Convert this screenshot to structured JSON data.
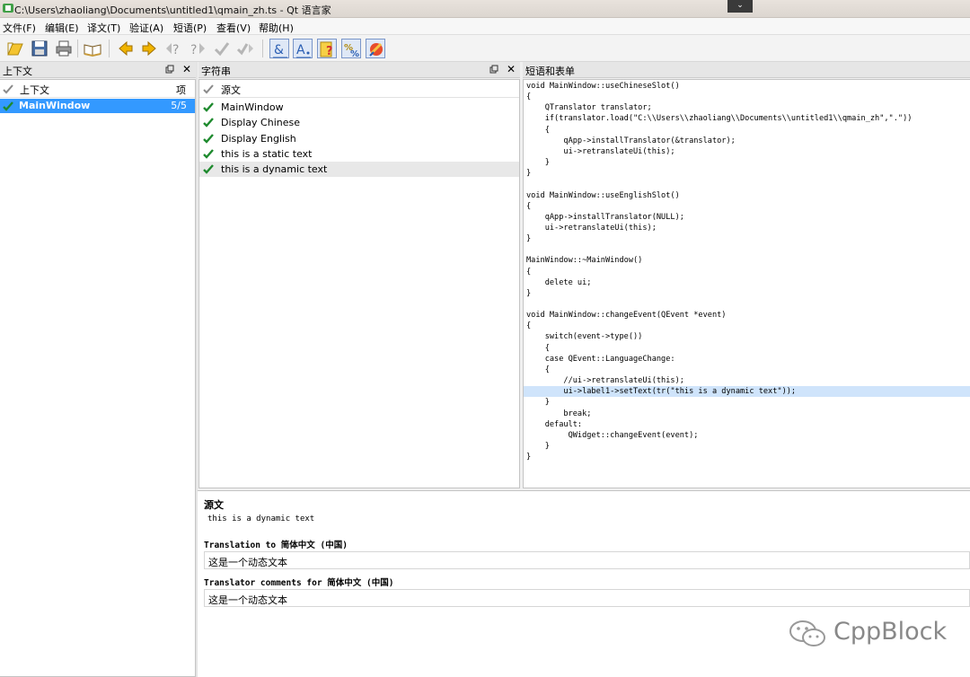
{
  "window": {
    "title": "C:\\Users\\zhaoliang\\Documents\\untitled1\\qmain_zh.ts - Qt 语言家",
    "minmax_glyph": "⌄"
  },
  "menu": [
    "文件(F)",
    "编辑(E)",
    "译文(T)",
    "验证(A)",
    "短语(P)",
    "查看(V)",
    "帮助(H)"
  ],
  "toolbar": {
    "icons": [
      "open-icon",
      "save-icon",
      "print-icon",
      "phrasebook-icon",
      "prev-icon",
      "next-icon",
      "prev-unfinished-icon",
      "next-unfinished-icon",
      "done-icon",
      "done-next-icon",
      "accelerators-check-icon",
      "punctuation-check-icon",
      "phrase-matches-check-icon",
      "placemarker-check-icon",
      "surrounding-whitespace-check-icon"
    ]
  },
  "context_panel": {
    "title": "上下文",
    "col_context": "上下文",
    "col_items": "项",
    "rows": [
      {
        "context": "MainWindow",
        "items": "5/5"
      }
    ]
  },
  "strings_panel": {
    "title": "字符串",
    "col_source": "源文",
    "rows": [
      {
        "text": "MainWindow",
        "selected": false
      },
      {
        "text": "Display Chinese",
        "selected": false
      },
      {
        "text": "Display English",
        "selected": false
      },
      {
        "text": "this is a static text",
        "selected": false
      },
      {
        "text": "this is a dynamic text",
        "selected": true
      }
    ]
  },
  "phrases_panel": {
    "title": "短语和表单",
    "code": [
      "void MainWindow::useChineseSlot()",
      "{",
      "    QTranslator translator;",
      "    if(translator.load(\"C:\\\\Users\\\\zhaoliang\\\\Documents\\\\untitled1\\\\qmain_zh\",\".\"))",
      "    {",
      "        qApp->installTranslator(&translator);",
      "        ui->retranslateUi(this);",
      "    }",
      "}",
      "",
      "void MainWindow::useEnglishSlot()",
      "{",
      "    qApp->installTranslator(NULL);",
      "    ui->retranslateUi(this);",
      "}",
      "",
      "MainWindow::~MainWindow()",
      "{",
      "    delete ui;",
      "}",
      "",
      "void MainWindow::changeEvent(QEvent *event)",
      "{",
      "    switch(event->type())",
      "    {",
      "    case QEvent::LanguageChange:",
      "    {",
      "        //ui->retranslateUi(this);",
      "        ui->label1->setText(tr(\"this is a dynamic text\"));",
      "    }",
      "        break;",
      "    default:",
      "         QWidget::changeEvent(event);",
      "    }",
      "}"
    ],
    "highlight_line": 28
  },
  "editor": {
    "source_label": "源文",
    "source_text": "this is a dynamic text",
    "translation_label": "Translation to 简体中文 (中国)",
    "translation_value": "这是一个动态文本",
    "comments_label": "Translator comments for 简体中文 (中国)",
    "comments_value": "这是一个动态文本"
  },
  "watermark": {
    "text": "CppBlock"
  }
}
